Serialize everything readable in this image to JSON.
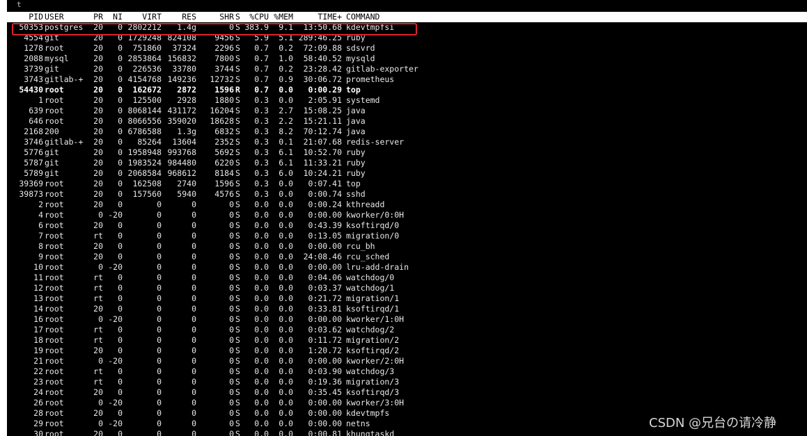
{
  "top_fragment": "t",
  "columns": {
    "pid": "PID",
    "user": "USER",
    "pr": "PR",
    "ni": "NI",
    "virt": "VIRT",
    "res": "RES",
    "shr": "SHR",
    "s": "S",
    "cpu": "%CPU",
    "mem": "%MEM",
    "time": "TIME+",
    "command": "COMMAND"
  },
  "processes": [
    {
      "pid": "50353",
      "user": "postgres",
      "pr": "20",
      "ni": "0",
      "virt": "2802212",
      "res": "1.4g",
      "shr": "0",
      "s": "S",
      "cpu": "383.9",
      "mem": "9.1",
      "time": "13:50.68",
      "command": "kdevtmpfsi"
    },
    {
      "pid": "4554",
      "user": "git",
      "pr": "20",
      "ni": "0",
      "virt": "1729248",
      "res": "824108",
      "shr": "9456",
      "s": "S",
      "cpu": "5.9",
      "mem": "5.1",
      "time": "289:46.25",
      "command": "ruby"
    },
    {
      "pid": "1278",
      "user": "root",
      "pr": "20",
      "ni": "0",
      "virt": "751860",
      "res": "37324",
      "shr": "2296",
      "s": "S",
      "cpu": "0.7",
      "mem": "0.2",
      "time": "72:09.88",
      "command": "sdsvrd"
    },
    {
      "pid": "2088",
      "user": "mysql",
      "pr": "20",
      "ni": "0",
      "virt": "2853864",
      "res": "156832",
      "shr": "7800",
      "s": "S",
      "cpu": "0.7",
      "mem": "1.0",
      "time": "58:40.52",
      "command": "mysqld"
    },
    {
      "pid": "3739",
      "user": "git",
      "pr": "20",
      "ni": "0",
      "virt": "226536",
      "res": "33780",
      "shr": "3744",
      "s": "S",
      "cpu": "0.7",
      "mem": "0.2",
      "time": "23:28.42",
      "command": "gitlab-exporter"
    },
    {
      "pid": "3743",
      "user": "gitlab-+",
      "pr": "20",
      "ni": "0",
      "virt": "4154768",
      "res": "149236",
      "shr": "12732",
      "s": "S",
      "cpu": "0.7",
      "mem": "0.9",
      "time": "30:06.72",
      "command": "prometheus"
    },
    {
      "pid": "54430",
      "user": "root",
      "pr": "20",
      "ni": "0",
      "virt": "162672",
      "res": "2872",
      "shr": "1596",
      "s": "R",
      "cpu": "0.7",
      "mem": "0.0",
      "time": "0:00.29",
      "command": "top",
      "bold": true
    },
    {
      "pid": "1",
      "user": "root",
      "pr": "20",
      "ni": "0",
      "virt": "125500",
      "res": "2928",
      "shr": "1880",
      "s": "S",
      "cpu": "0.3",
      "mem": "0.0",
      "time": "2:05.91",
      "command": "systemd"
    },
    {
      "pid": "639",
      "user": "root",
      "pr": "20",
      "ni": "0",
      "virt": "8068144",
      "res": "431172",
      "shr": "16204",
      "s": "S",
      "cpu": "0.3",
      "mem": "2.7",
      "time": "15:08.25",
      "command": "java"
    },
    {
      "pid": "646",
      "user": "root",
      "pr": "20",
      "ni": "0",
      "virt": "8066556",
      "res": "359020",
      "shr": "18628",
      "s": "S",
      "cpu": "0.3",
      "mem": "2.2",
      "time": "15:21.11",
      "command": "java"
    },
    {
      "pid": "2168",
      "user": "200",
      "pr": "20",
      "ni": "0",
      "virt": "6786588",
      "res": "1.3g",
      "shr": "6832",
      "s": "S",
      "cpu": "0.3",
      "mem": "8.2",
      "time": "70:12.74",
      "command": "java"
    },
    {
      "pid": "3746",
      "user": "gitlab-+",
      "pr": "20",
      "ni": "0",
      "virt": "85264",
      "res": "13604",
      "shr": "2352",
      "s": "S",
      "cpu": "0.3",
      "mem": "0.1",
      "time": "21:07.68",
      "command": "redis-server"
    },
    {
      "pid": "5776",
      "user": "git",
      "pr": "20",
      "ni": "0",
      "virt": "1958948",
      "res": "993768",
      "shr": "5692",
      "s": "S",
      "cpu": "0.3",
      "mem": "6.1",
      "time": "10:52.70",
      "command": "ruby"
    },
    {
      "pid": "5787",
      "user": "git",
      "pr": "20",
      "ni": "0",
      "virt": "1983524",
      "res": "984480",
      "shr": "6220",
      "s": "S",
      "cpu": "0.3",
      "mem": "6.1",
      "time": "11:33.21",
      "command": "ruby"
    },
    {
      "pid": "5789",
      "user": "git",
      "pr": "20",
      "ni": "0",
      "virt": "2068584",
      "res": "968612",
      "shr": "8184",
      "s": "S",
      "cpu": "0.3",
      "mem": "6.0",
      "time": "10:24.21",
      "command": "ruby"
    },
    {
      "pid": "39369",
      "user": "root",
      "pr": "20",
      "ni": "0",
      "virt": "162508",
      "res": "2740",
      "shr": "1596",
      "s": "S",
      "cpu": "0.3",
      "mem": "0.0",
      "time": "0:07.41",
      "command": "top"
    },
    {
      "pid": "39873",
      "user": "root",
      "pr": "20",
      "ni": "0",
      "virt": "157560",
      "res": "5940",
      "shr": "4576",
      "s": "S",
      "cpu": "0.3",
      "mem": "0.0",
      "time": "0:00.74",
      "command": "sshd"
    },
    {
      "pid": "2",
      "user": "root",
      "pr": "20",
      "ni": "0",
      "virt": "0",
      "res": "0",
      "shr": "0",
      "s": "S",
      "cpu": "0.0",
      "mem": "0.0",
      "time": "0:00.24",
      "command": "kthreadd"
    },
    {
      "pid": "4",
      "user": "root",
      "pr": "0",
      "ni": "-20",
      "virt": "0",
      "res": "0",
      "shr": "0",
      "s": "S",
      "cpu": "0.0",
      "mem": "0.0",
      "time": "0:00.00",
      "command": "kworker/0:0H"
    },
    {
      "pid": "6",
      "user": "root",
      "pr": "20",
      "ni": "0",
      "virt": "0",
      "res": "0",
      "shr": "0",
      "s": "S",
      "cpu": "0.0",
      "mem": "0.0",
      "time": "0:43.39",
      "command": "ksoftirqd/0"
    },
    {
      "pid": "7",
      "user": "root",
      "pr": "rt",
      "ni": "0",
      "virt": "0",
      "res": "0",
      "shr": "0",
      "s": "S",
      "cpu": "0.0",
      "mem": "0.0",
      "time": "0:13.05",
      "command": "migration/0"
    },
    {
      "pid": "8",
      "user": "root",
      "pr": "20",
      "ni": "0",
      "virt": "0",
      "res": "0",
      "shr": "0",
      "s": "S",
      "cpu": "0.0",
      "mem": "0.0",
      "time": "0:00.00",
      "command": "rcu_bh"
    },
    {
      "pid": "9",
      "user": "root",
      "pr": "20",
      "ni": "0",
      "virt": "0",
      "res": "0",
      "shr": "0",
      "s": "S",
      "cpu": "0.0",
      "mem": "0.0",
      "time": "24:08.46",
      "command": "rcu_sched"
    },
    {
      "pid": "10",
      "user": "root",
      "pr": "0",
      "ni": "-20",
      "virt": "0",
      "res": "0",
      "shr": "0",
      "s": "S",
      "cpu": "0.0",
      "mem": "0.0",
      "time": "0:00.00",
      "command": "lru-add-drain"
    },
    {
      "pid": "11",
      "user": "root",
      "pr": "rt",
      "ni": "0",
      "virt": "0",
      "res": "0",
      "shr": "0",
      "s": "S",
      "cpu": "0.0",
      "mem": "0.0",
      "time": "0:04.06",
      "command": "watchdog/0"
    },
    {
      "pid": "12",
      "user": "root",
      "pr": "rt",
      "ni": "0",
      "virt": "0",
      "res": "0",
      "shr": "0",
      "s": "S",
      "cpu": "0.0",
      "mem": "0.0",
      "time": "0:03.37",
      "command": "watchdog/1"
    },
    {
      "pid": "13",
      "user": "root",
      "pr": "rt",
      "ni": "0",
      "virt": "0",
      "res": "0",
      "shr": "0",
      "s": "S",
      "cpu": "0.0",
      "mem": "0.0",
      "time": "0:21.72",
      "command": "migration/1"
    },
    {
      "pid": "14",
      "user": "root",
      "pr": "20",
      "ni": "0",
      "virt": "0",
      "res": "0",
      "shr": "0",
      "s": "S",
      "cpu": "0.0",
      "mem": "0.0",
      "time": "0:33.81",
      "command": "ksoftirqd/1"
    },
    {
      "pid": "16",
      "user": "root",
      "pr": "0",
      "ni": "-20",
      "virt": "0",
      "res": "0",
      "shr": "0",
      "s": "S",
      "cpu": "0.0",
      "mem": "0.0",
      "time": "0:00.00",
      "command": "kworker/1:0H"
    },
    {
      "pid": "17",
      "user": "root",
      "pr": "rt",
      "ni": "0",
      "virt": "0",
      "res": "0",
      "shr": "0",
      "s": "S",
      "cpu": "0.0",
      "mem": "0.0",
      "time": "0:03.62",
      "command": "watchdog/2"
    },
    {
      "pid": "18",
      "user": "root",
      "pr": "rt",
      "ni": "0",
      "virt": "0",
      "res": "0",
      "shr": "0",
      "s": "S",
      "cpu": "0.0",
      "mem": "0.0",
      "time": "0:11.72",
      "command": "migration/2"
    },
    {
      "pid": "19",
      "user": "root",
      "pr": "20",
      "ni": "0",
      "virt": "0",
      "res": "0",
      "shr": "0",
      "s": "S",
      "cpu": "0.0",
      "mem": "0.0",
      "time": "1:20.72",
      "command": "ksoftirqd/2"
    },
    {
      "pid": "21",
      "user": "root",
      "pr": "0",
      "ni": "-20",
      "virt": "0",
      "res": "0",
      "shr": "0",
      "s": "S",
      "cpu": "0.0",
      "mem": "0.0",
      "time": "0:00.00",
      "command": "kworker/2:0H"
    },
    {
      "pid": "22",
      "user": "root",
      "pr": "rt",
      "ni": "0",
      "virt": "0",
      "res": "0",
      "shr": "0",
      "s": "S",
      "cpu": "0.0",
      "mem": "0.0",
      "time": "0:03.90",
      "command": "watchdog/3"
    },
    {
      "pid": "23",
      "user": "root",
      "pr": "rt",
      "ni": "0",
      "virt": "0",
      "res": "0",
      "shr": "0",
      "s": "S",
      "cpu": "0.0",
      "mem": "0.0",
      "time": "0:19.36",
      "command": "migration/3"
    },
    {
      "pid": "24",
      "user": "root",
      "pr": "20",
      "ni": "0",
      "virt": "0",
      "res": "0",
      "shr": "0",
      "s": "S",
      "cpu": "0.0",
      "mem": "0.0",
      "time": "0:35.45",
      "command": "ksoftirqd/3"
    },
    {
      "pid": "26",
      "user": "root",
      "pr": "0",
      "ni": "-20",
      "virt": "0",
      "res": "0",
      "shr": "0",
      "s": "S",
      "cpu": "0.0",
      "mem": "0.0",
      "time": "0:00.00",
      "command": "kworker/3:0H"
    },
    {
      "pid": "28",
      "user": "root",
      "pr": "20",
      "ni": "0",
      "virt": "0",
      "res": "0",
      "shr": "0",
      "s": "S",
      "cpu": "0.0",
      "mem": "0.0",
      "time": "0:00.00",
      "command": "kdevtmpfs"
    },
    {
      "pid": "29",
      "user": "root",
      "pr": "0",
      "ni": "-20",
      "virt": "0",
      "res": "0",
      "shr": "0",
      "s": "S",
      "cpu": "0.0",
      "mem": "0.0",
      "time": "0:00.00",
      "command": "netns"
    },
    {
      "pid": "30",
      "user": "root",
      "pr": "20",
      "ni": "0",
      "virt": "0",
      "res": "0",
      "shr": "0",
      "s": "S",
      "cpu": "0.0",
      "mem": "0.0",
      "time": "0:00.81",
      "command": "khungtaskd"
    }
  ],
  "watermark": "CSDN @兄台の请冷静",
  "colors": {
    "terminal_bg": "#000000",
    "header_bg": "#ffffff",
    "highlight_border": "#e0232e"
  }
}
